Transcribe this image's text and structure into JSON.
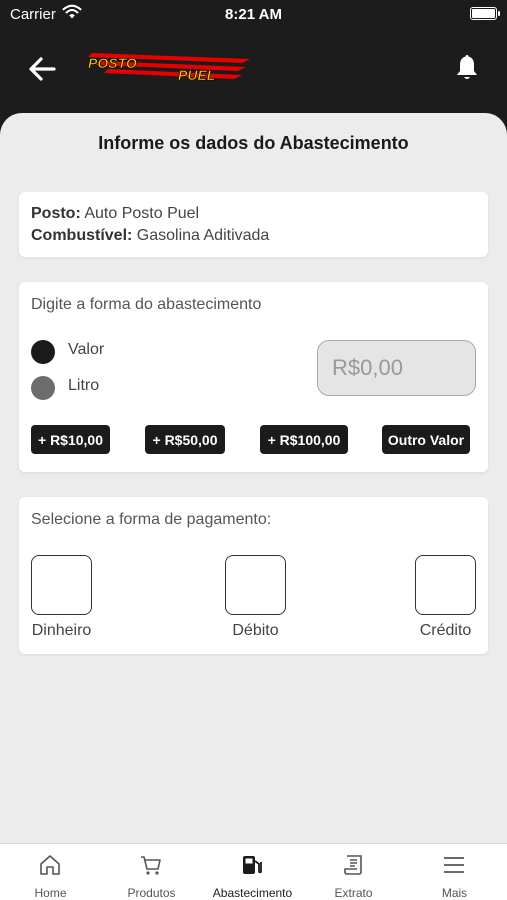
{
  "status_bar": {
    "carrier": "Carrier",
    "time": "8:21 AM"
  },
  "header": {
    "logo_text_1": "POSTO",
    "logo_text_2": "PUEL",
    "logo_accent": "#ff0000",
    "logo_color": "#ffcc00"
  },
  "page": {
    "title": "Informe os dados do Abastecimento"
  },
  "station_info": {
    "posto_label": "Posto:",
    "posto_value": "Auto Posto Puel",
    "combustivel_label": "Combustível:",
    "combustivel_value": "Gasolina Aditivada"
  },
  "fuel_form": {
    "label": "Digite a forma do abastecimento",
    "option_valor": "Valor",
    "option_litro": "Litro",
    "selected": "Valor",
    "amount_placeholder": "R$0,00",
    "quick_amounts": [
      "+ R$10,00",
      "+ R$50,00",
      "+ R$100,00",
      "Outro Valor"
    ]
  },
  "payment": {
    "label": "Selecione a forma de pagamento:",
    "options": [
      "Dinheiro",
      "Débito",
      "Crédito"
    ]
  },
  "bottom_nav": {
    "items": [
      "Home",
      "Produtos",
      "Abastecimento",
      "Extrato",
      "Mais"
    ],
    "active": "Abastecimento",
    "icons": [
      "home-icon",
      "cart-icon",
      "fuel-pump-icon",
      "receipt-icon",
      "menu-icon"
    ]
  }
}
